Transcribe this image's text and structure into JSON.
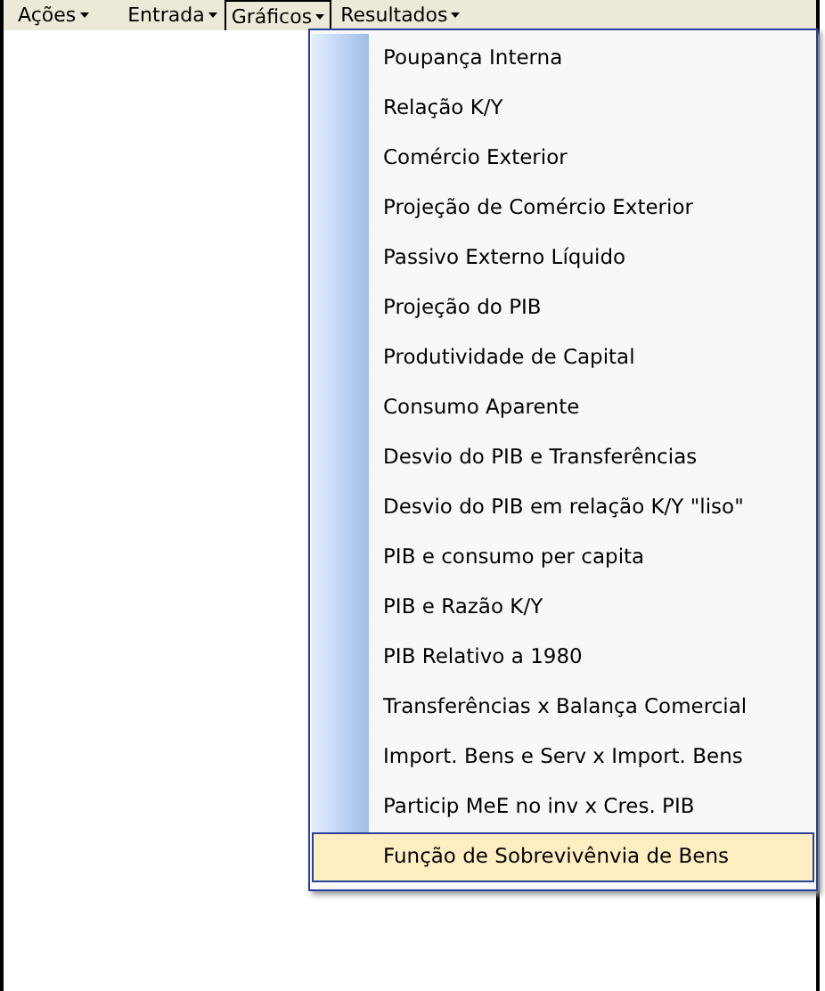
{
  "menubar": [
    {
      "label": "Ações",
      "selected": false
    },
    {
      "label": "Entrada",
      "selected": false
    },
    {
      "label": "Gráficos",
      "selected": true
    },
    {
      "label": "Resultados",
      "selected": false
    }
  ],
  "dropdown": {
    "items": [
      {
        "label": "Poupança Interna",
        "selected": false
      },
      {
        "label": "Relação K/Y",
        "selected": false
      },
      {
        "label": "Comércio Exterior",
        "selected": false
      },
      {
        "label": "Projeção de Comércio Exterior",
        "selected": false
      },
      {
        "label": "Passivo Externo Líquido",
        "selected": false
      },
      {
        "label": "Projeção do PIB",
        "selected": false
      },
      {
        "label": "Produtividade de Capital",
        "selected": false
      },
      {
        "label": "Consumo Aparente",
        "selected": false
      },
      {
        "label": "Desvio do PIB e Transferências",
        "selected": false
      },
      {
        "label": "Desvio do PIB em relação K/Y \"liso\"",
        "selected": false
      },
      {
        "label": "PIB e consumo per capita",
        "selected": false
      },
      {
        "label": "PIB e Razão K/Y",
        "selected": false
      },
      {
        "label": "PIB Relativo a 1980",
        "selected": false
      },
      {
        "label": "Transferências x Balança Comercial",
        "selected": false
      },
      {
        "label": "Import. Bens e Serv x Import. Bens",
        "selected": false
      },
      {
        "label": "Particip MeE no inv x Cres. PIB",
        "selected": false
      },
      {
        "label": "Função de Sobrevivênvia de Bens",
        "selected": true
      }
    ]
  }
}
